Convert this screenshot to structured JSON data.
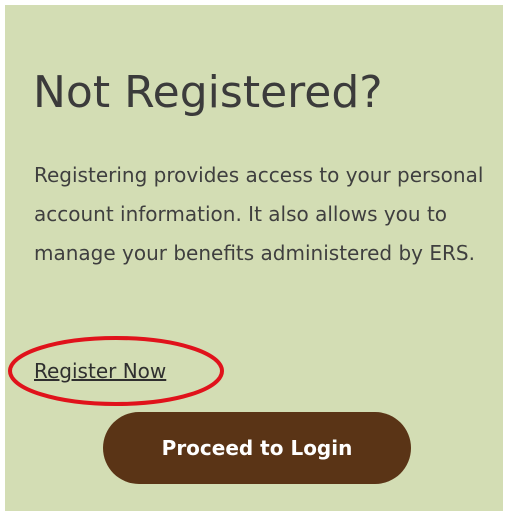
{
  "card": {
    "title": "Not Registered?",
    "description": "Registering provides access to your personal account information. It also allows you to manage your benefits administered by ERS.",
    "register_link": "Register Now",
    "login_button": "Proceed to Login"
  },
  "colors": {
    "card_background": "#d3ddb4",
    "button_background": "#5a3416",
    "annotation": "#e0121b"
  }
}
